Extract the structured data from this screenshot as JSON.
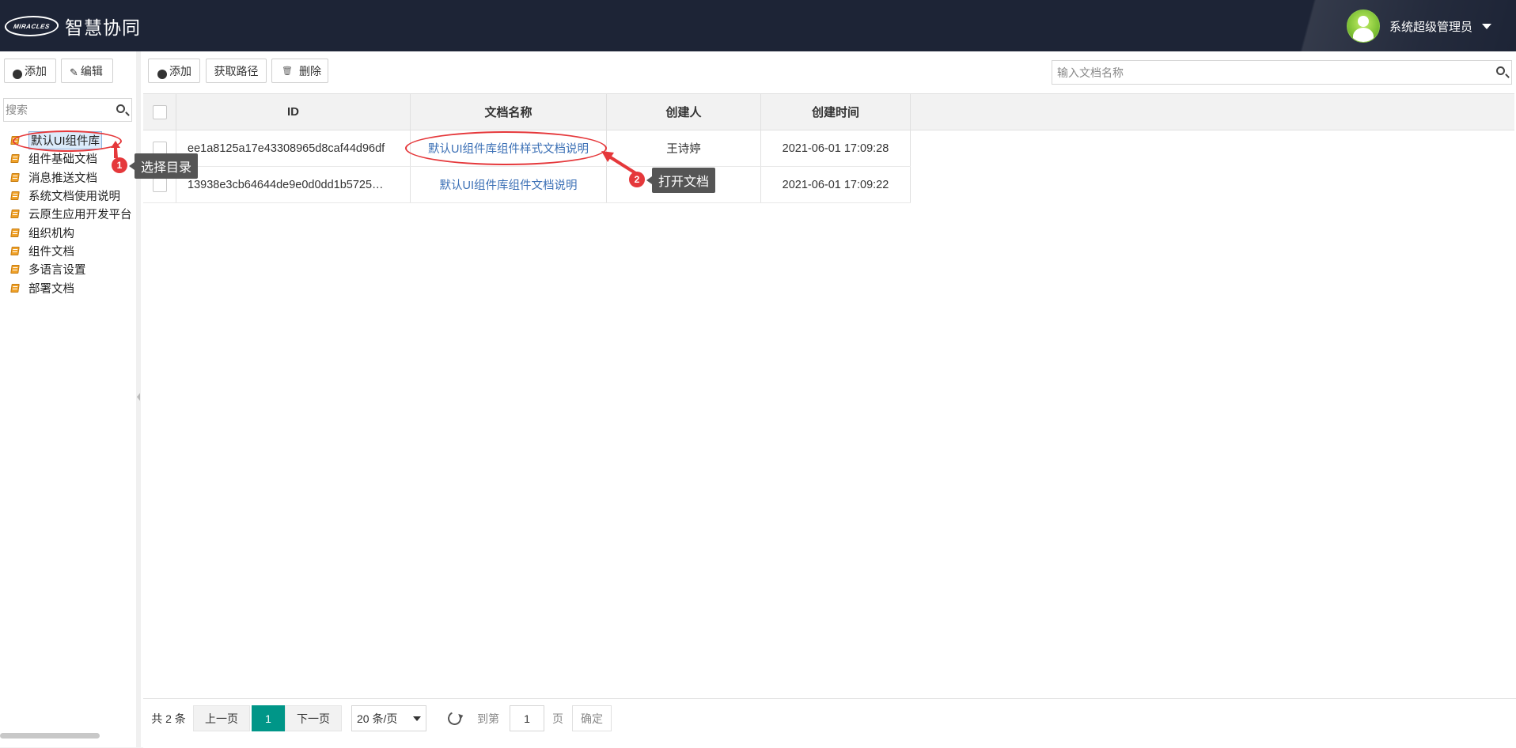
{
  "header": {
    "logo_mark": "MIRACLES",
    "app_title": "智慧协同",
    "user_name": "系统超级管理员"
  },
  "sidebar": {
    "add_label": "添加",
    "edit_label": "编辑",
    "search_placeholder": "搜索",
    "tree_items": [
      {
        "label": "默认UI组件库",
        "selected": true
      },
      {
        "label": "组件基础文档"
      },
      {
        "label": "消息推送文档"
      },
      {
        "label": "系统文档使用说明"
      },
      {
        "label": "云原生应用开发平台"
      },
      {
        "label": "组织机构"
      },
      {
        "label": "组件文档"
      },
      {
        "label": "多语言设置"
      },
      {
        "label": "部署文档"
      }
    ]
  },
  "toolbar": {
    "add_label": "添加",
    "get_path_label": "获取路径",
    "delete_label": "删除",
    "search_placeholder": "输入文档名称"
  },
  "table": {
    "columns": [
      "ID",
      "文档名称",
      "创建人",
      "创建时间"
    ],
    "rows": [
      {
        "id": "ee1a8125a17e43308965d8caf44d96df",
        "name": "默认UI组件库组件样式文档说明",
        "creator": "王诗婷",
        "created": "2021-06-01 17:09:28"
      },
      {
        "id": "13938e3cb64644de9e0d0dd1b5725…",
        "name": "默认UI组件库组件文档说明",
        "creator": "",
        "created": "2021-06-01 17:09:22"
      }
    ]
  },
  "pager": {
    "total": "共 2 条",
    "prev": "上一页",
    "current": "1",
    "next": "下一页",
    "page_size": "20 条/页",
    "goto_label": "到第",
    "goto_value": "1",
    "page_unit": "页",
    "confirm": "确定"
  },
  "annotations": [
    {
      "number": "1",
      "text": "选择目录"
    },
    {
      "number": "2",
      "text": "打开文档"
    }
  ],
  "colors": {
    "header_bg": "#1d2436",
    "annotation_red": "#e5383b",
    "pager_active": "#009688",
    "link": "#3a6fb5"
  }
}
